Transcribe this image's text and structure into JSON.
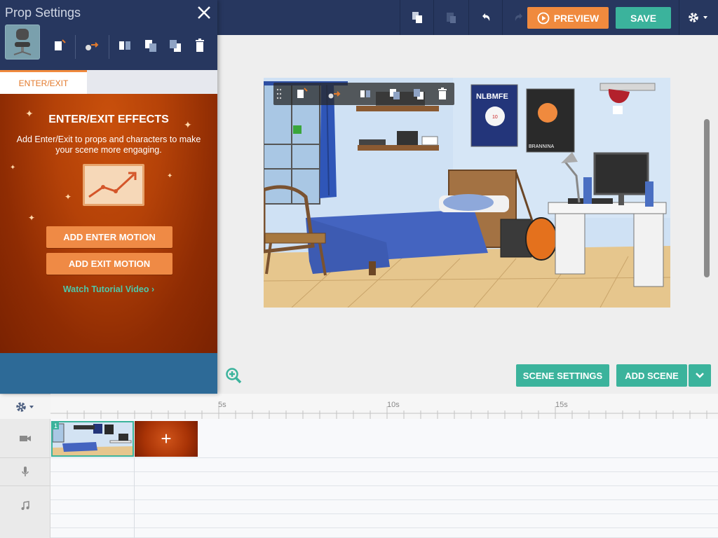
{
  "topbar": {
    "preview_label": "PREVIEW",
    "save_label": "SAVE"
  },
  "panel": {
    "title": "Prop Settings",
    "tab_label": "ENTER/EXIT",
    "effects": {
      "heading": "ENTER/EXIT EFFECTS",
      "description": "Add Enter/Exit to props and characters to make your scene more engaging.",
      "add_enter_label": "ADD ENTER MOTION",
      "add_exit_label": "ADD EXIT MOTION",
      "tutorial_label": "Watch Tutorial Video"
    }
  },
  "scene": {
    "poster_left_text": "NLBMFE",
    "poster_left_number": "10",
    "poster_right_text": "BRANNINA"
  },
  "canvas": {
    "scene_settings_label": "SCENE SETTINGS",
    "add_scene_label": "ADD SCENE"
  },
  "timeline": {
    "ticks": [
      "5s",
      "10s",
      "15s"
    ],
    "scene_number": "1",
    "add_tile_glyph": "+"
  },
  "colors": {
    "navy": "#27375f",
    "orange": "#f08a3e",
    "green": "#3bb39c",
    "panel_blue": "#2d6a97"
  }
}
